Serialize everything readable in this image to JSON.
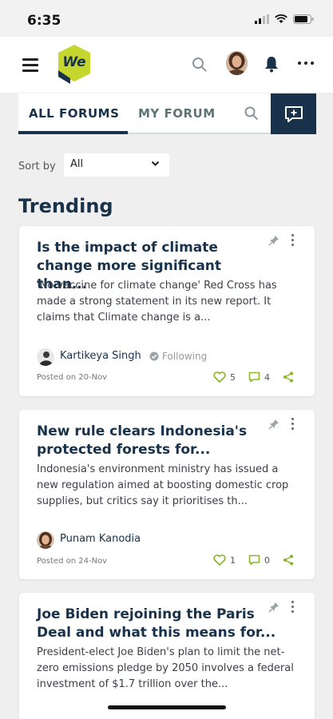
{
  "status_bar": {
    "time": "6:35"
  },
  "header": {
    "logo_text": "We"
  },
  "tabs": {
    "all": "ALL FORUMS",
    "my": "MY FORUM"
  },
  "sort": {
    "label": "Sort by",
    "value": "All"
  },
  "section_title": "Trending",
  "posts": [
    {
      "title": "Is the impact of climate change more significant than...",
      "body": "'No vaccine for climate change' Red Cross has made a strong statement in its new report. It claims that Climate change is a...",
      "author": "Kartikeya Singh",
      "following": "Following",
      "posted": "Posted on 20-Nov",
      "likes": "5",
      "comments": "4"
    },
    {
      "title": "New rule clears Indonesia's protected forests for...",
      "body": "Indonesia's environment ministry has issued a new regulation aimed at boosting domestic crop supplies, but critics say it prioritises th...",
      "author": "Punam Kanodia",
      "posted": "Posted on 24-Nov",
      "likes": "1",
      "comments": "0"
    },
    {
      "title": "Joe Biden rejoining the Paris Deal and what this means for...",
      "body": "President-elect Joe Biden's plan to limit the net-zero emissions pledge by 2050 involves a federal investment of $1.7 trillion over the..."
    }
  ],
  "colors": {
    "primary": "#17324a",
    "accent": "#c5d62e",
    "stat_green": "#8ab526"
  }
}
